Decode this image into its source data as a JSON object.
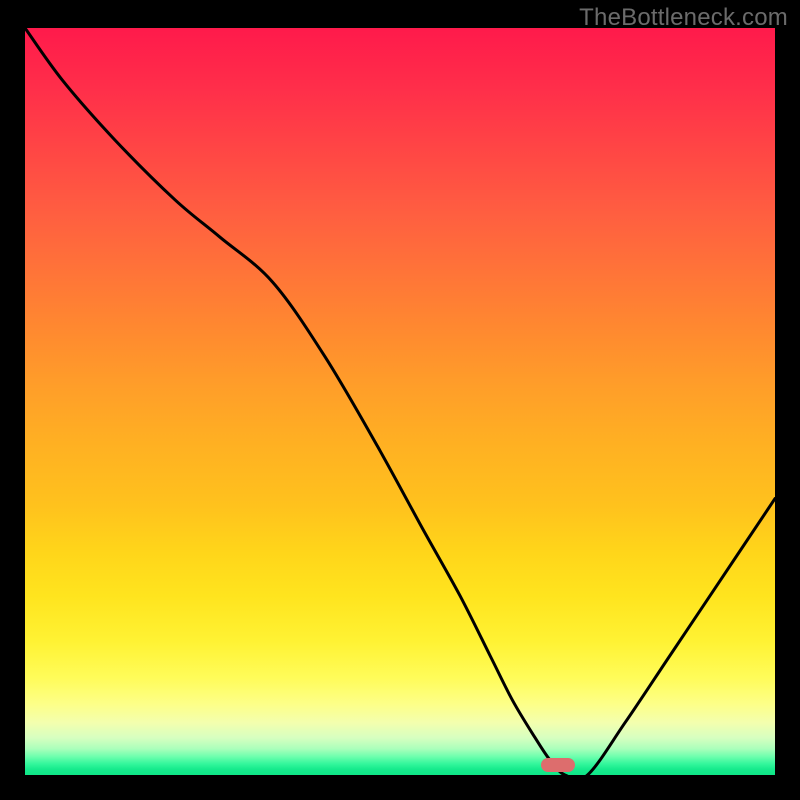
{
  "watermark": "TheBottleneck.com",
  "chart_data": {
    "type": "line",
    "title": "",
    "xlabel": "",
    "ylabel": "",
    "xlim": [
      0,
      100
    ],
    "ylim": [
      0,
      100
    ],
    "grid": false,
    "series": [
      {
        "name": "bottleneck-curve",
        "x": [
          0,
          5,
          12,
          20,
          26,
          33,
          40,
          47,
          53,
          58,
          62,
          65,
          68,
          70,
          72,
          75,
          80,
          86,
          92,
          100
        ],
        "values": [
          100,
          93,
          85,
          77,
          72,
          66,
          56,
          44,
          33,
          24,
          16,
          10,
          5,
          2,
          0,
          0,
          7,
          16,
          25,
          37
        ]
      }
    ],
    "marker": {
      "x": 71,
      "y": 1.4,
      "color": "#dd6d6d"
    },
    "background_gradient": {
      "top": "#ff1a4b",
      "mid": "#ffd51a",
      "bottom": "#0fe688"
    }
  }
}
